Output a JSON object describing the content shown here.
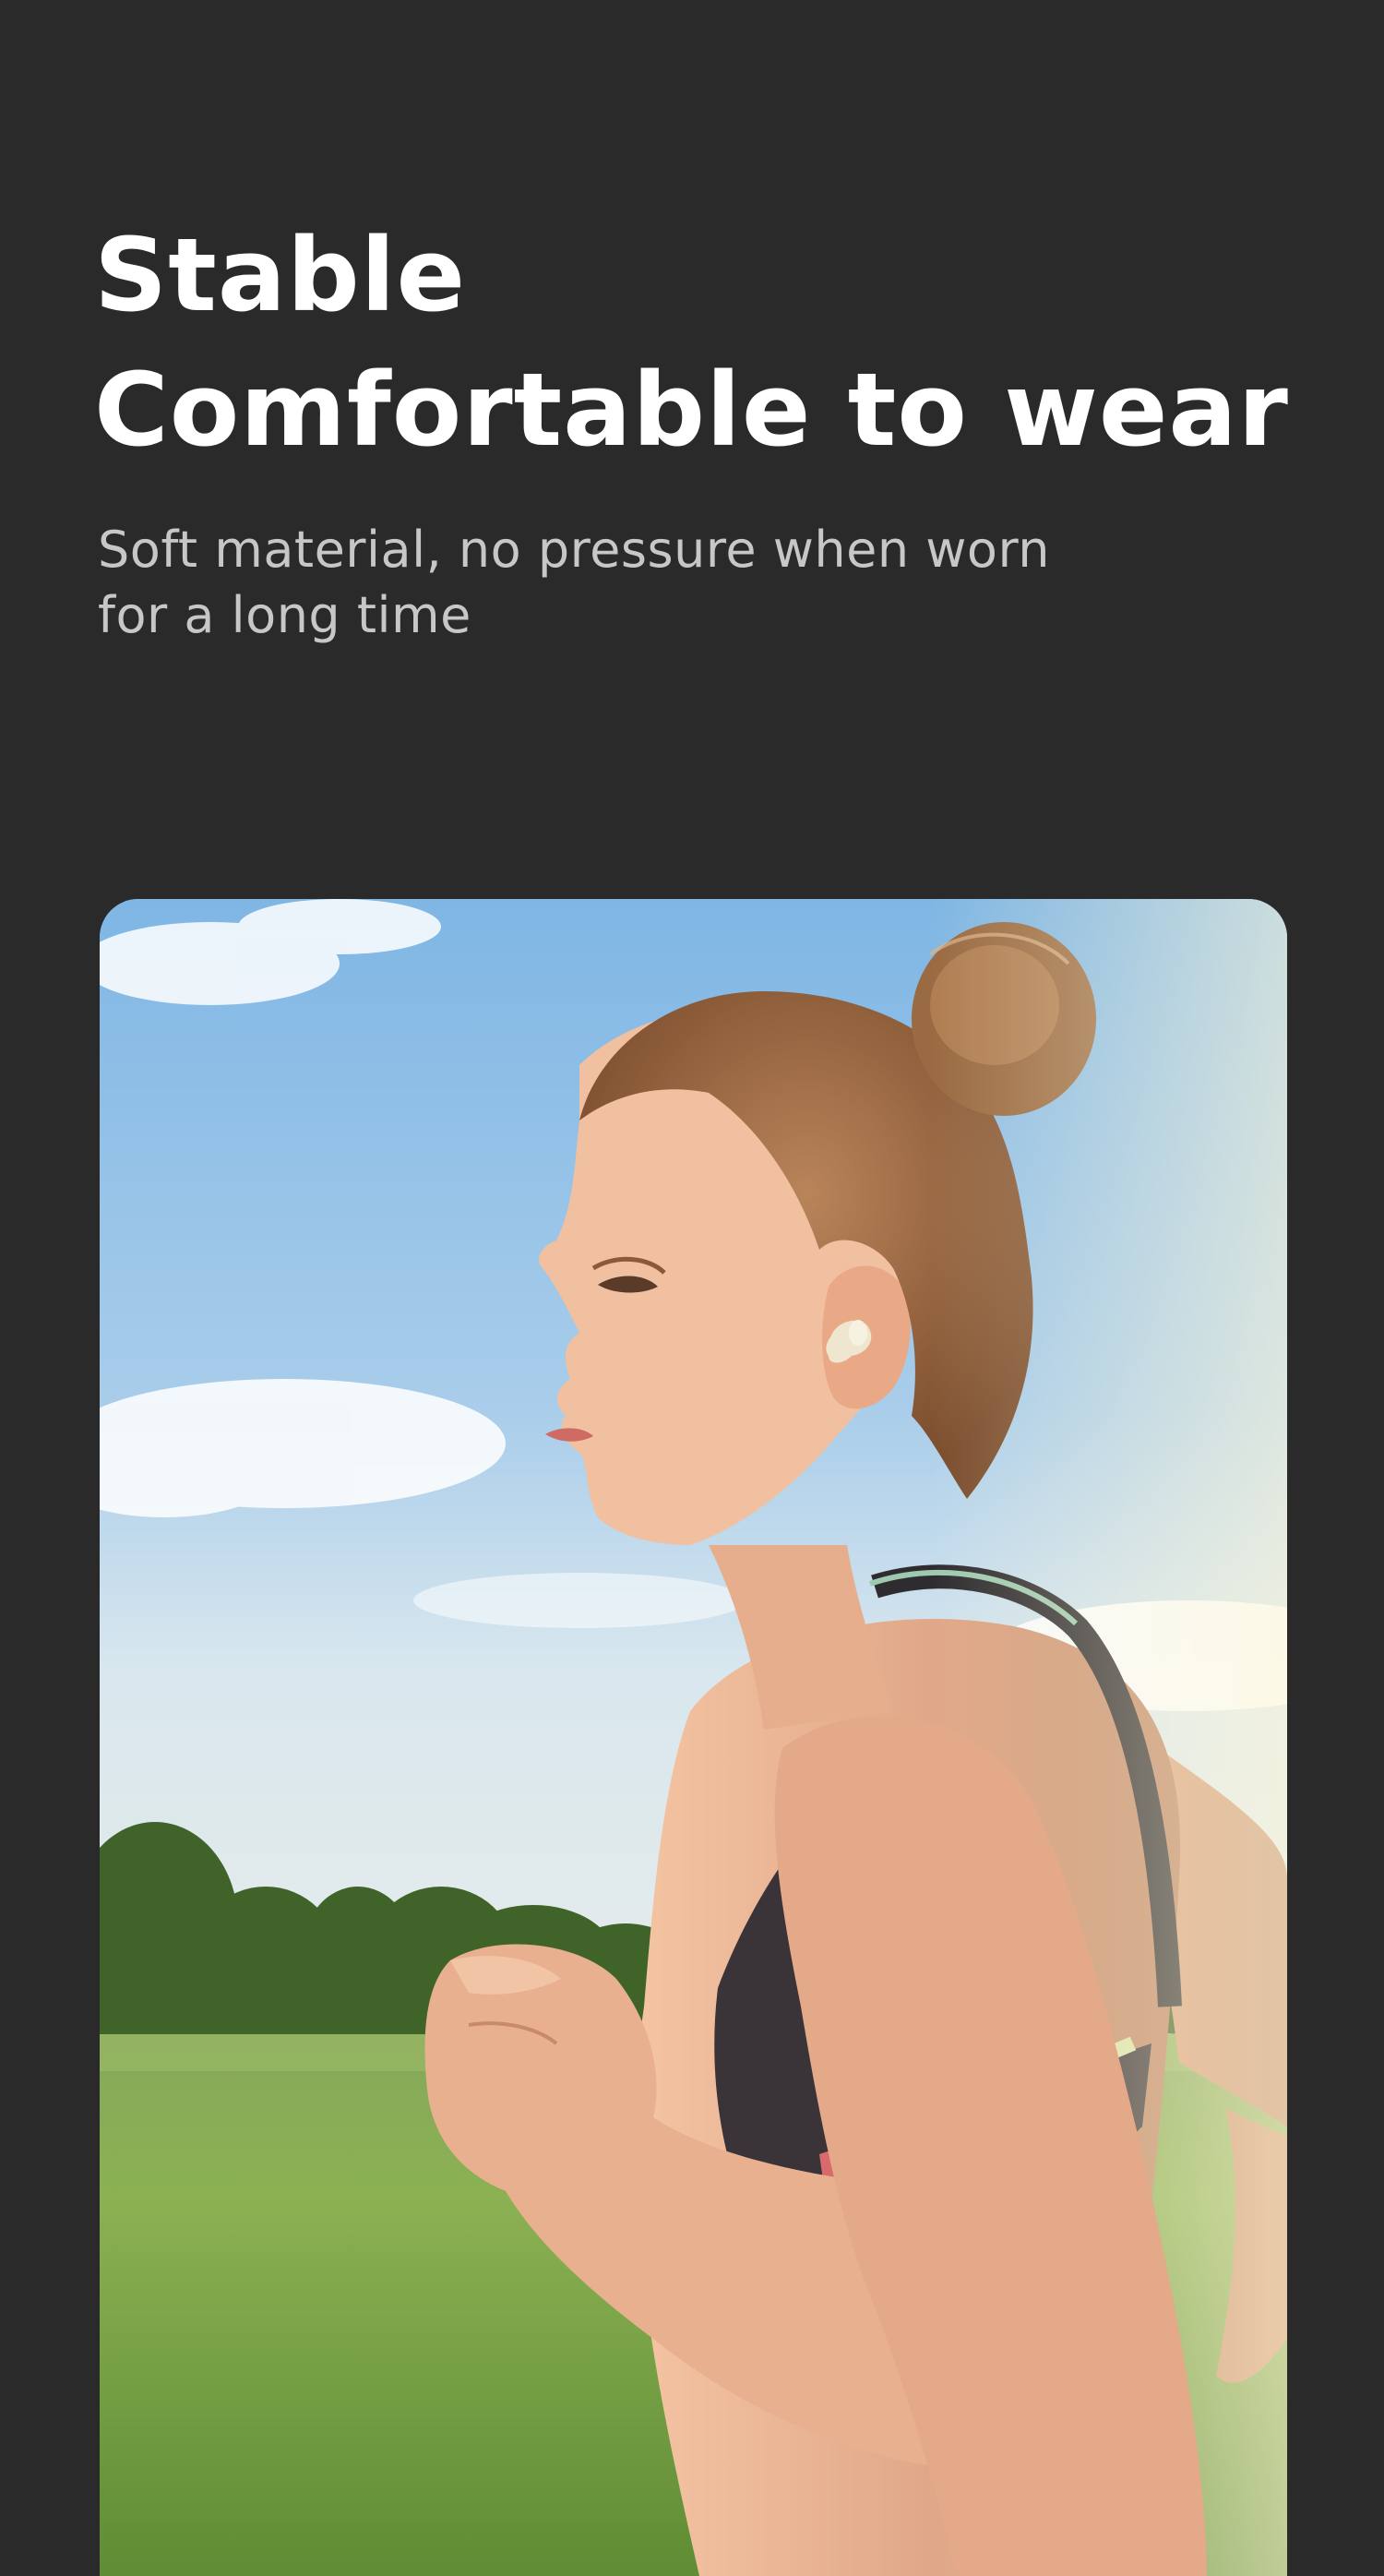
{
  "headline": {
    "line1": "Stable",
    "line2": "Comfortable to wear"
  },
  "subtitle": {
    "line1": "Soft material, no pressure when worn",
    "line2": "for a long time"
  },
  "colors": {
    "background": "#2a2a2a",
    "headline": "#ffffff",
    "subtitle": "#c7c7c7"
  },
  "photo": {
    "subject": "woman-running-with-earbud",
    "earbud_color": "#efe6cf"
  }
}
